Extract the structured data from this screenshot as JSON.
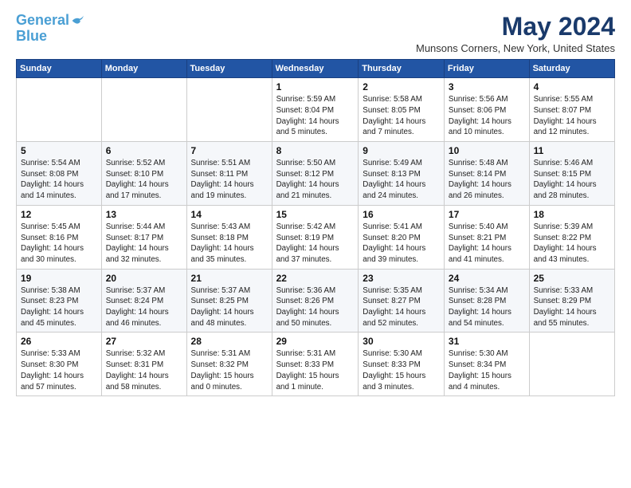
{
  "logo": {
    "line1": "General",
    "line2": "Blue"
  },
  "title": "May 2024",
  "location": "Munsons Corners, New York, United States",
  "days_header": [
    "Sunday",
    "Monday",
    "Tuesday",
    "Wednesday",
    "Thursday",
    "Friday",
    "Saturday"
  ],
  "weeks": [
    [
      {
        "day": "",
        "info": ""
      },
      {
        "day": "",
        "info": ""
      },
      {
        "day": "",
        "info": ""
      },
      {
        "day": "1",
        "info": "Sunrise: 5:59 AM\nSunset: 8:04 PM\nDaylight: 14 hours\nand 5 minutes."
      },
      {
        "day": "2",
        "info": "Sunrise: 5:58 AM\nSunset: 8:05 PM\nDaylight: 14 hours\nand 7 minutes."
      },
      {
        "day": "3",
        "info": "Sunrise: 5:56 AM\nSunset: 8:06 PM\nDaylight: 14 hours\nand 10 minutes."
      },
      {
        "day": "4",
        "info": "Sunrise: 5:55 AM\nSunset: 8:07 PM\nDaylight: 14 hours\nand 12 minutes."
      }
    ],
    [
      {
        "day": "5",
        "info": "Sunrise: 5:54 AM\nSunset: 8:08 PM\nDaylight: 14 hours\nand 14 minutes."
      },
      {
        "day": "6",
        "info": "Sunrise: 5:52 AM\nSunset: 8:10 PM\nDaylight: 14 hours\nand 17 minutes."
      },
      {
        "day": "7",
        "info": "Sunrise: 5:51 AM\nSunset: 8:11 PM\nDaylight: 14 hours\nand 19 minutes."
      },
      {
        "day": "8",
        "info": "Sunrise: 5:50 AM\nSunset: 8:12 PM\nDaylight: 14 hours\nand 21 minutes."
      },
      {
        "day": "9",
        "info": "Sunrise: 5:49 AM\nSunset: 8:13 PM\nDaylight: 14 hours\nand 24 minutes."
      },
      {
        "day": "10",
        "info": "Sunrise: 5:48 AM\nSunset: 8:14 PM\nDaylight: 14 hours\nand 26 minutes."
      },
      {
        "day": "11",
        "info": "Sunrise: 5:46 AM\nSunset: 8:15 PM\nDaylight: 14 hours\nand 28 minutes."
      }
    ],
    [
      {
        "day": "12",
        "info": "Sunrise: 5:45 AM\nSunset: 8:16 PM\nDaylight: 14 hours\nand 30 minutes."
      },
      {
        "day": "13",
        "info": "Sunrise: 5:44 AM\nSunset: 8:17 PM\nDaylight: 14 hours\nand 32 minutes."
      },
      {
        "day": "14",
        "info": "Sunrise: 5:43 AM\nSunset: 8:18 PM\nDaylight: 14 hours\nand 35 minutes."
      },
      {
        "day": "15",
        "info": "Sunrise: 5:42 AM\nSunset: 8:19 PM\nDaylight: 14 hours\nand 37 minutes."
      },
      {
        "day": "16",
        "info": "Sunrise: 5:41 AM\nSunset: 8:20 PM\nDaylight: 14 hours\nand 39 minutes."
      },
      {
        "day": "17",
        "info": "Sunrise: 5:40 AM\nSunset: 8:21 PM\nDaylight: 14 hours\nand 41 minutes."
      },
      {
        "day": "18",
        "info": "Sunrise: 5:39 AM\nSunset: 8:22 PM\nDaylight: 14 hours\nand 43 minutes."
      }
    ],
    [
      {
        "day": "19",
        "info": "Sunrise: 5:38 AM\nSunset: 8:23 PM\nDaylight: 14 hours\nand 45 minutes."
      },
      {
        "day": "20",
        "info": "Sunrise: 5:37 AM\nSunset: 8:24 PM\nDaylight: 14 hours\nand 46 minutes."
      },
      {
        "day": "21",
        "info": "Sunrise: 5:37 AM\nSunset: 8:25 PM\nDaylight: 14 hours\nand 48 minutes."
      },
      {
        "day": "22",
        "info": "Sunrise: 5:36 AM\nSunset: 8:26 PM\nDaylight: 14 hours\nand 50 minutes."
      },
      {
        "day": "23",
        "info": "Sunrise: 5:35 AM\nSunset: 8:27 PM\nDaylight: 14 hours\nand 52 minutes."
      },
      {
        "day": "24",
        "info": "Sunrise: 5:34 AM\nSunset: 8:28 PM\nDaylight: 14 hours\nand 54 minutes."
      },
      {
        "day": "25",
        "info": "Sunrise: 5:33 AM\nSunset: 8:29 PM\nDaylight: 14 hours\nand 55 minutes."
      }
    ],
    [
      {
        "day": "26",
        "info": "Sunrise: 5:33 AM\nSunset: 8:30 PM\nDaylight: 14 hours\nand 57 minutes."
      },
      {
        "day": "27",
        "info": "Sunrise: 5:32 AM\nSunset: 8:31 PM\nDaylight: 14 hours\nand 58 minutes."
      },
      {
        "day": "28",
        "info": "Sunrise: 5:31 AM\nSunset: 8:32 PM\nDaylight: 15 hours\nand 0 minutes."
      },
      {
        "day": "29",
        "info": "Sunrise: 5:31 AM\nSunset: 8:33 PM\nDaylight: 15 hours\nand 1 minute."
      },
      {
        "day": "30",
        "info": "Sunrise: 5:30 AM\nSunset: 8:33 PM\nDaylight: 15 hours\nand 3 minutes."
      },
      {
        "day": "31",
        "info": "Sunrise: 5:30 AM\nSunset: 8:34 PM\nDaylight: 15 hours\nand 4 minutes."
      },
      {
        "day": "",
        "info": ""
      }
    ]
  ]
}
